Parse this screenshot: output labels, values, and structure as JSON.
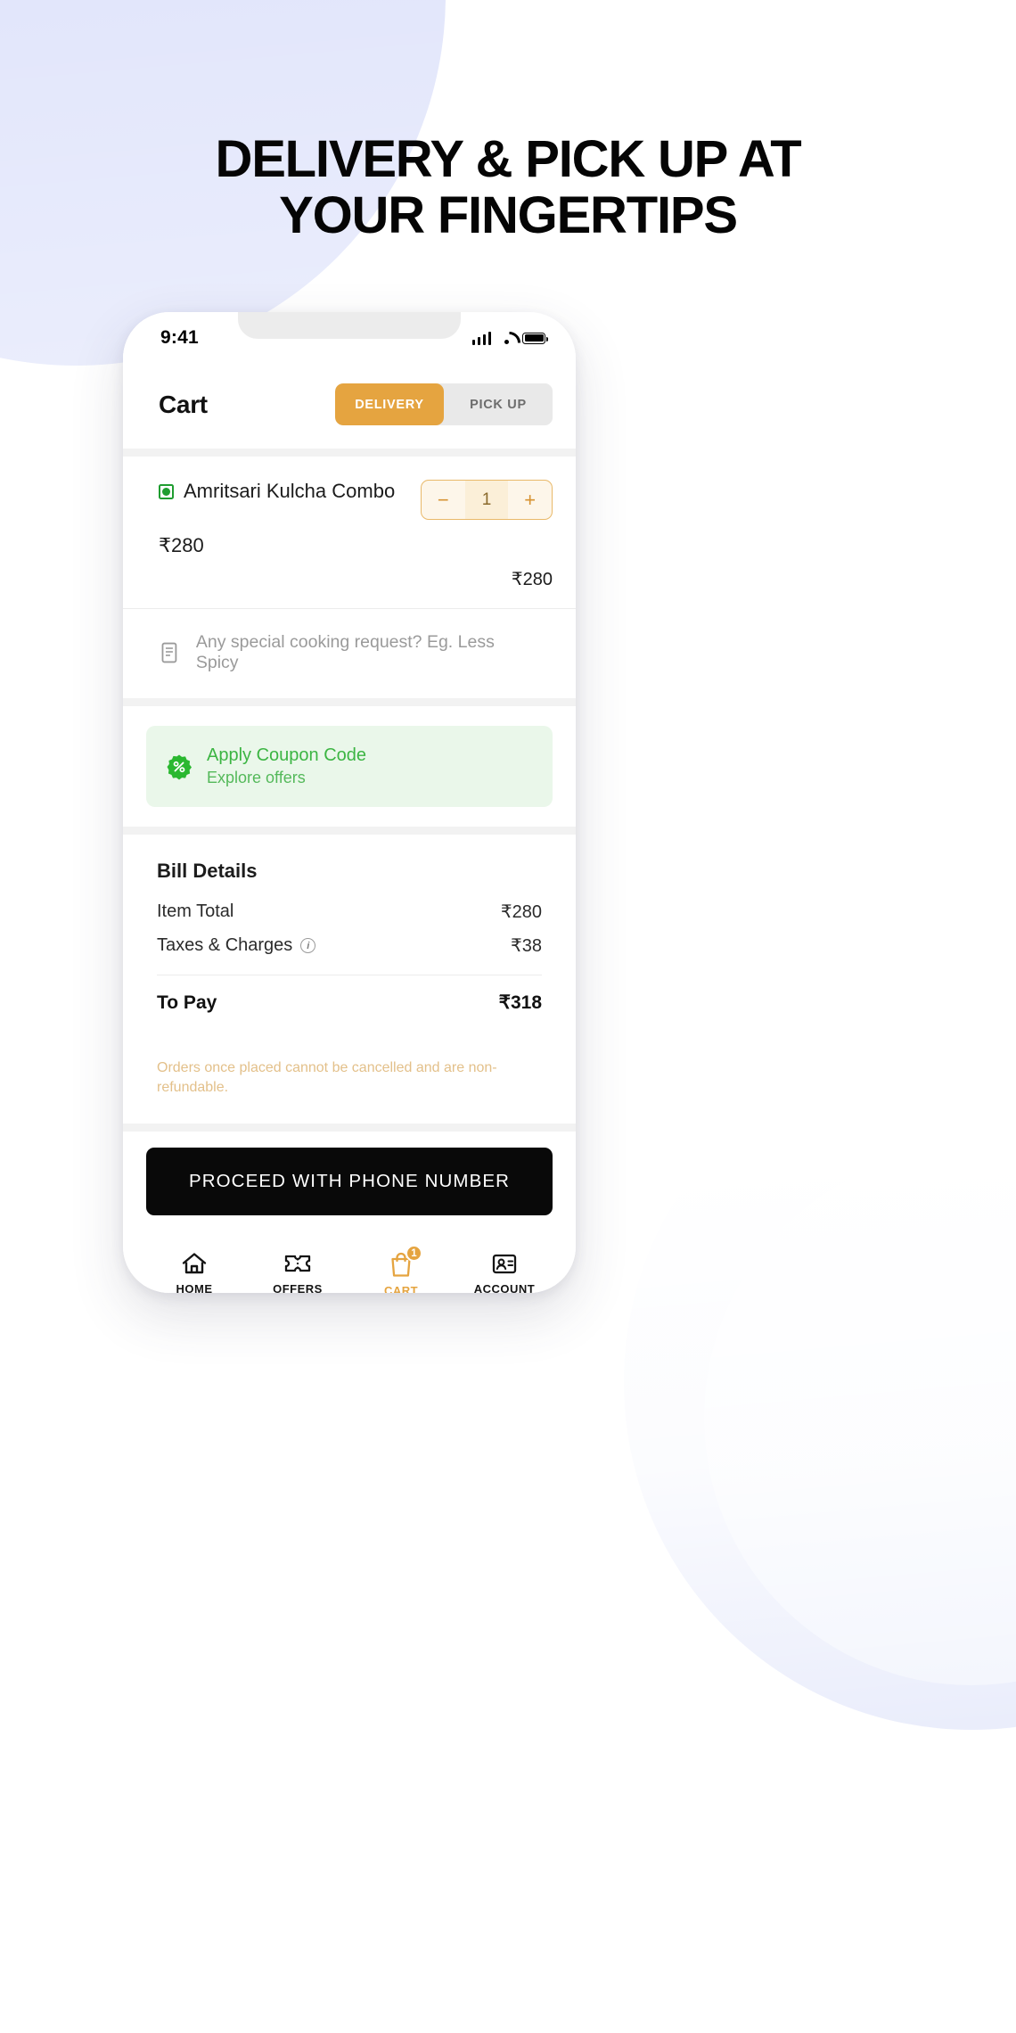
{
  "promo": {
    "headline_line1": "DELIVERY & PICK UP AT",
    "headline_line2": "YOUR FINGERTIPS"
  },
  "colors": {
    "accent_orange": "#e5a440",
    "coupon_green": "#3cb543",
    "coupon_bg": "#eaf7ea",
    "disclaimer": "#e3c08a",
    "cta_black": "#090909",
    "blob_lavender": "#e2e6fb",
    "blob_periwinkle": "#c9d2f5"
  },
  "status_bar": {
    "time": "9:41",
    "signal_icon": "cellular-signal-icon",
    "wifi_icon": "wifi-icon",
    "battery_icon": "battery-full-icon"
  },
  "header": {
    "title": "Cart",
    "toggle": {
      "options": [
        "DELIVERY",
        "PICK UP"
      ],
      "selected": "DELIVERY"
    }
  },
  "cart_item": {
    "veg_indicator": "veg-marker-icon",
    "name": "Amritsari Kulcha Combo",
    "unit_price": "₹280",
    "line_total": "₹280",
    "quantity": "1",
    "decrement_label": "−",
    "increment_label": "+"
  },
  "cooking_request": {
    "icon": "note-icon",
    "placeholder": "Any special cooking request? Eg. Less Spicy"
  },
  "coupon": {
    "icon": "percent-badge-icon",
    "title": "Apply Coupon Code",
    "subtitle": "Explore offers"
  },
  "bill": {
    "title": "Bill Details",
    "rows": [
      {
        "label": "Item Total",
        "value": "₹280",
        "info_icon": null
      },
      {
        "label": "Taxes & Charges",
        "value": "₹38",
        "info_icon": "info-circle-icon"
      }
    ],
    "to_pay_label": "To Pay",
    "to_pay_value": "₹318",
    "disclaimer": "Orders once placed cannot be cancelled and are non-refundable."
  },
  "cta": {
    "label": "PROCEED WITH PHONE NUMBER"
  },
  "tabbar": {
    "items": [
      {
        "label": "HOME",
        "icon": "home-icon",
        "active": false,
        "badge": null
      },
      {
        "label": "OFFERS",
        "icon": "ticket-icon",
        "active": false,
        "badge": null
      },
      {
        "label": "CART",
        "icon": "bag-icon",
        "active": true,
        "badge": "1"
      },
      {
        "label": "ACCOUNT",
        "icon": "id-card-icon",
        "active": false,
        "badge": null
      }
    ]
  }
}
